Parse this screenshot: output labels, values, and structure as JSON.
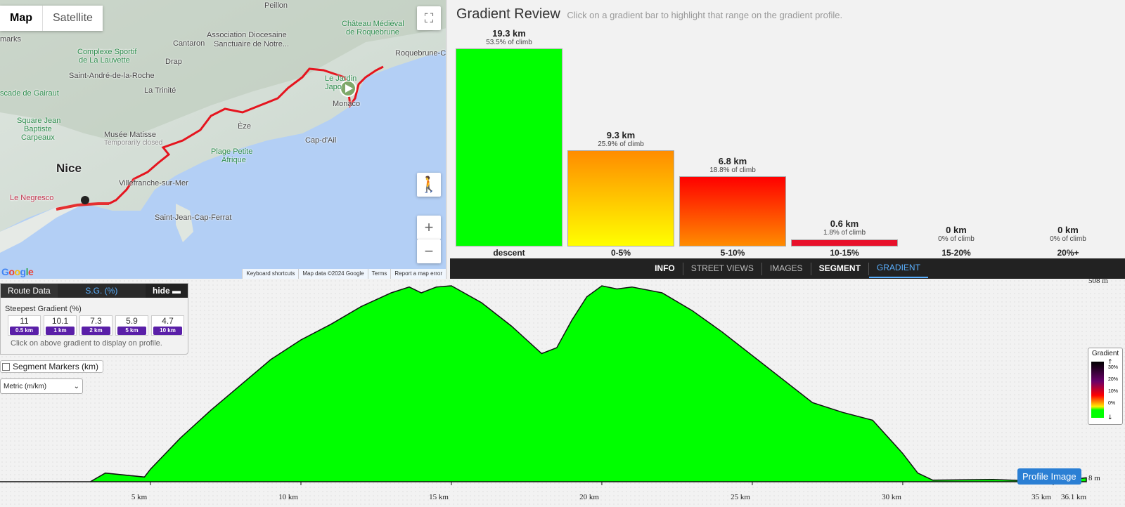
{
  "map": {
    "type_buttons": [
      "Map",
      "Satellite"
    ],
    "labels": {
      "nice": "Nice",
      "monaco": "Monaco",
      "eze": "Èze",
      "cap_dail": "Cap-d'Ail",
      "villefranche": "Villefranche-sur-Mer",
      "saint_jean": "Saint-Jean-Cap-Ferrat",
      "la_trinite": "La Trinité",
      "drap": "Drap",
      "cantaron": "Cantaron",
      "saint_andre": "Saint-André-de-la-Roche",
      "roquebrune": "Roquebrune-C",
      "peillon": "Peillon",
      "association": "Association Diocesaine",
      "sanctuaire": "Sanctuaire de Notre...",
      "chateau": "Château Médiéval",
      "de_roquebrune": "de Roquebrune",
      "complexe": "Complexe Sportif",
      "lauvette": "de La Lauvette",
      "cascade": "scade de Gairaut",
      "square1": "Square Jean",
      "square2": "Baptiste",
      "square3": "Carpeaux",
      "musee": "Musée Matisse",
      "temp_closed": "Temporarily closed",
      "plage1": "Plage Petite",
      "plage2": "Afrique",
      "negresco": "Le Negresco",
      "marks": "marks",
      "le_jardin": "Le Jardin",
      "japonais": "Japo"
    },
    "footer": [
      "Keyboard shortcuts",
      "Map data ©2024 Google",
      "Terms",
      "Report a map error"
    ],
    "google": "Google"
  },
  "review": {
    "title": "Gradient Review",
    "subtitle": "Click on a gradient bar to highlight that range on the gradient profile.",
    "bars": [
      {
        "dist": "19.3 km",
        "pct": "53.5% of climb",
        "cat": "descent"
      },
      {
        "dist": "9.3 km",
        "pct": "25.9% of climb",
        "cat": "0-5%"
      },
      {
        "dist": "6.8 km",
        "pct": "18.8% of climb",
        "cat": "5-10%"
      },
      {
        "dist": "0.6 km",
        "pct": "1.8% of climb",
        "cat": "10-15%"
      },
      {
        "dist": "0 km",
        "pct": "0% of climb",
        "cat": "15-20%"
      },
      {
        "dist": "0 km",
        "pct": "0% of climb",
        "cat": "20%+"
      }
    ]
  },
  "tabs": [
    "INFO",
    "STREET VIEWS",
    "IMAGES",
    "SEGMENT",
    "GRADIENT"
  ],
  "route_panel": {
    "tab_route": "Route Data",
    "tab_sg": "S.G. (%)",
    "tab_hide": "hide",
    "title": "Steepest Gradient (%)",
    "boxes": [
      {
        "v": "11",
        "d": "0.5 km"
      },
      {
        "v": "10.1",
        "d": "1 km"
      },
      {
        "v": "7.3",
        "d": "2 km"
      },
      {
        "v": "5.9",
        "d": "5 km"
      },
      {
        "v": "4.7",
        "d": "10 km"
      }
    ],
    "hint": "Click on above gradient to display on profile."
  },
  "segment_markers": "Segment Markers (km)",
  "units": "Metric (m/km)",
  "profile": {
    "max_elev": "508 m",
    "min_elev": "8 m",
    "x_ticks": [
      "5 km",
      "10 km",
      "15 km",
      "20 km",
      "25 km",
      "30 km",
      "35 km",
      "36.1 km"
    ],
    "legend_title": "Gradient",
    "legend_ticks": [
      "30%",
      "20%",
      "10%",
      "0%"
    ],
    "button": "Profile Image"
  },
  "chart_data": {
    "type": "area",
    "title": "",
    "xlabel": "",
    "ylabel": "",
    "xlim": [
      0,
      36.1
    ],
    "ylim": [
      8,
      508
    ],
    "x": [
      0,
      3.0,
      3.5,
      4.8,
      5.0,
      6.0,
      7.0,
      8.0,
      9.0,
      10.0,
      11.0,
      12.0,
      13.0,
      13.6,
      14.0,
      14.5,
      15.0,
      16.0,
      17.0,
      17.5,
      18.0,
      18.5,
      19.0,
      19.5,
      20.0,
      20.5,
      21.0,
      22.0,
      23.0,
      24.0,
      25.0,
      26.0,
      27.0,
      28.0,
      29.0,
      30.0,
      30.5,
      31.0,
      33.0,
      35.0,
      36.1
    ],
    "y": [
      8,
      8,
      30,
      20,
      40,
      120,
      190,
      255,
      320,
      370,
      410,
      455,
      490,
      505,
      490,
      505,
      508,
      465,
      405,
      370,
      335,
      350,
      420,
      480,
      508,
      500,
      505,
      490,
      445,
      390,
      330,
      270,
      210,
      185,
      165,
      80,
      30,
      12,
      14,
      8,
      18
    ],
    "legend": [
      "descent",
      "0-5%",
      "5-10%",
      "10-15%",
      "15-20%",
      "20%+"
    ]
  }
}
